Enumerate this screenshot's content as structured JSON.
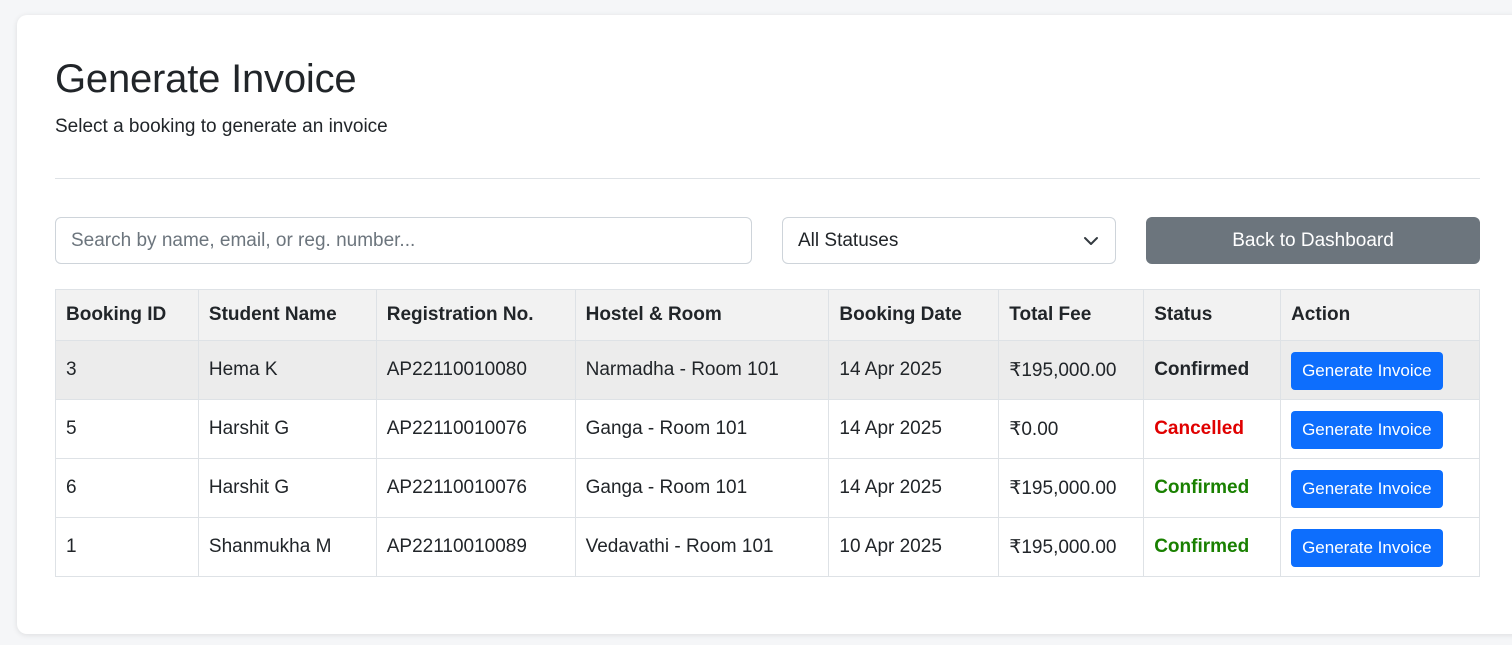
{
  "header": {
    "title": "Generate Invoice",
    "subtitle": "Select a booking to generate an invoice"
  },
  "filters": {
    "search_placeholder": "Search by name, email, or reg. number...",
    "search_value": "",
    "status_selected": "All Statuses",
    "back_label": "Back to Dashboard"
  },
  "table": {
    "headers": [
      "Booking ID",
      "Student Name",
      "Registration No.",
      "Hostel & Room",
      "Booking Date",
      "Total Fee",
      "Status",
      "Action"
    ],
    "rows": [
      {
        "booking_id": "3",
        "student": "Hema K",
        "reg_no": "AP22110010080",
        "hostel_room": "Narmadha - Room 101",
        "date": "14 Apr 2025",
        "fee": "₹195,000.00",
        "status": "Confirmed",
        "action": "Generate Invoice"
      },
      {
        "booking_id": "5",
        "student": "Harshit G",
        "reg_no": "AP22110010076",
        "hostel_room": "Ganga - Room 101",
        "date": "14 Apr 2025",
        "fee": "₹0.00",
        "status": "Cancelled",
        "action": "Generate Invoice"
      },
      {
        "booking_id": "6",
        "student": "Harshit G",
        "reg_no": "AP22110010076",
        "hostel_room": "Ganga - Room 101",
        "date": "14 Apr 2025",
        "fee": "₹195,000.00",
        "status": "Confirmed",
        "action": "Generate Invoice"
      },
      {
        "booking_id": "1",
        "student": "Shanmukha M",
        "reg_no": "AP22110010089",
        "hostel_room": "Vedavathi - Room 101",
        "date": "10 Apr 2025",
        "fee": "₹195,000.00",
        "status": "Confirmed",
        "action": "Generate Invoice"
      }
    ]
  },
  "colors": {
    "primary": "#0d6efd",
    "secondary": "#6c757d",
    "confirmed": "#198000",
    "cancelled": "#e00000"
  }
}
